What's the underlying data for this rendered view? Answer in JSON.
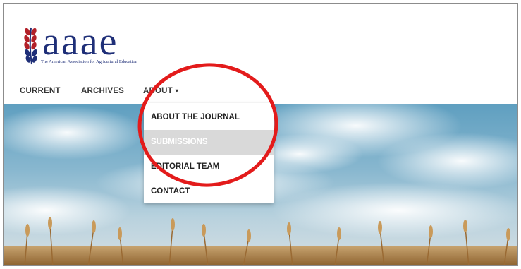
{
  "logo": {
    "letters": "aaae",
    "tagline": "The American Association for Agricultural Education",
    "wheat_icon": "wheat-icon"
  },
  "nav": {
    "current": "CURRENT",
    "archives": "ARCHIVES",
    "about": "ABOUT",
    "about_caret": "▾"
  },
  "dropdown": {
    "items": [
      "ABOUT THE JOURNAL",
      "SUBMISSIONS",
      "EDITORIAL TEAM",
      "CONTACT"
    ],
    "highlighted": "SUBMISSIONS"
  },
  "colors": {
    "brand_blue": "#1f2f78",
    "brand_red": "#b22028",
    "annotation_red": "#e31b1b",
    "highlight_bg": "#d9d9d9"
  }
}
